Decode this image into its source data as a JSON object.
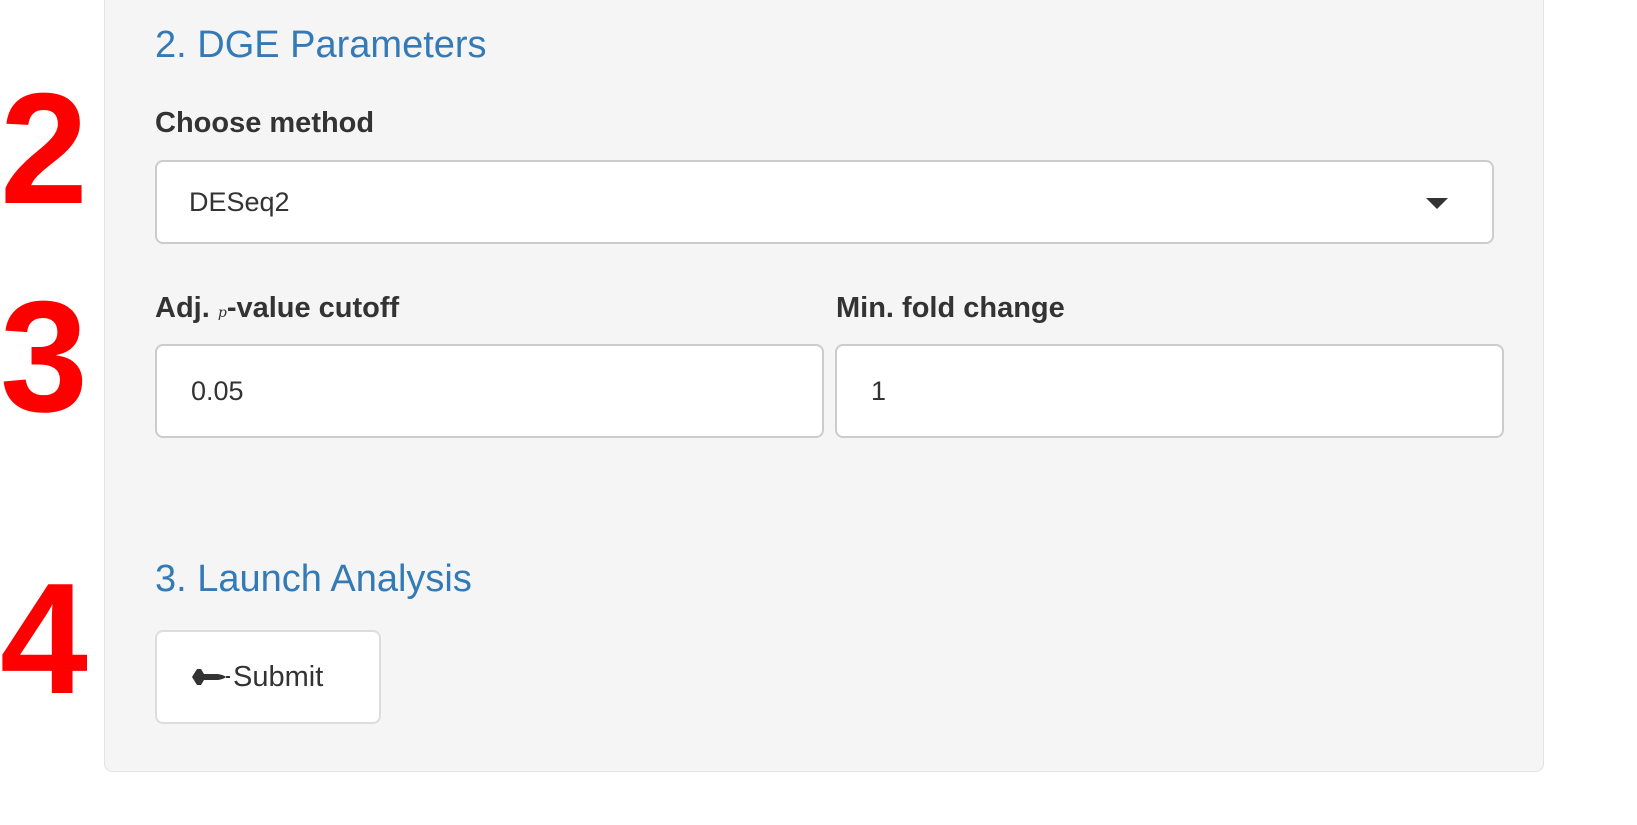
{
  "markers": [
    "2",
    "3",
    "4"
  ],
  "dge_parameters": {
    "title": "2. DGE Parameters",
    "method": {
      "label": "Choose method",
      "selected": "DESeq2"
    },
    "pvalue": {
      "label_prefix": "Adj. ",
      "label_var": "p",
      "label_suffix": "-value cutoff",
      "value": "0.05"
    },
    "fold_change": {
      "label": "Min. fold change",
      "value": "1"
    }
  },
  "launch": {
    "title": "3. Launch Analysis",
    "submit_label": "Submit",
    "submit_icon": "space-shuttle-icon"
  },
  "colors": {
    "section_title": "#337ab7",
    "marker": "#ff0000",
    "well_background": "#f5f5f5"
  }
}
